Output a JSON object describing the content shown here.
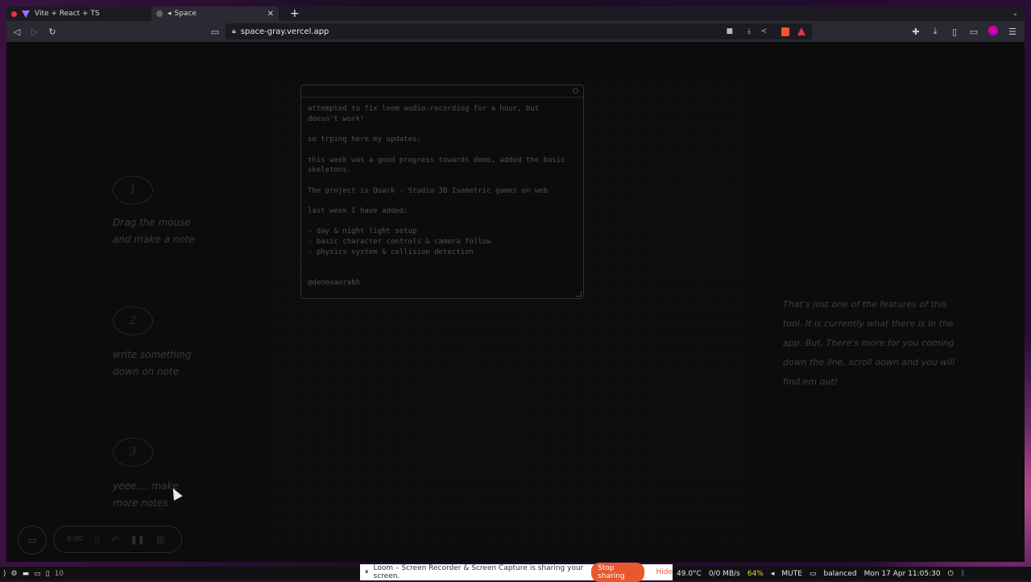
{
  "browser": {
    "tabs": [
      {
        "label": "Vite + React + TS"
      },
      {
        "label": "Space"
      }
    ],
    "url": "space-gray.vercel.app"
  },
  "steps": [
    {
      "number": "1",
      "line1": "Drag the mouse",
      "line2": "and make a note"
    },
    {
      "number": "2",
      "line1": "write something",
      "line2": "down on note"
    },
    {
      "number": "3",
      "line1": "yeee.... make",
      "line2": "more notes"
    }
  ],
  "note": {
    "body": "attempted to fix loom audio-recording for a hour, but\ndoesn't work!\n\nso trping here my updates:\n\nthis week was a good progress towards demo, added the basic\nskeletons.\n\nThe project is Quark - Studio 3D Isometric games on web\n\nlast week I have added:\n\n- day & night light setup\n- basic character controls & camera follow\n- physics system & collision detection\n\n\n@denosaurabh"
  },
  "feature_text": "That's just one of the features of this tool. It is currently what there is in the app. But, There's more for you coming down the line, scroll down and you will find em out!",
  "recorder": {
    "time": "0:00"
  },
  "share": {
    "text": "Loom – Screen Recorder & Screen Capture is sharing your screen.",
    "stop": "Stop sharing",
    "hide": "Hide"
  },
  "taskbar": {
    "workspace": "10",
    "temp": "49.0°C",
    "net": "0/0 MB/s",
    "battery": "64%",
    "volume": "MUTE",
    "power": "balanced",
    "datetime": "Mon 17 Apr 11:05:30"
  }
}
